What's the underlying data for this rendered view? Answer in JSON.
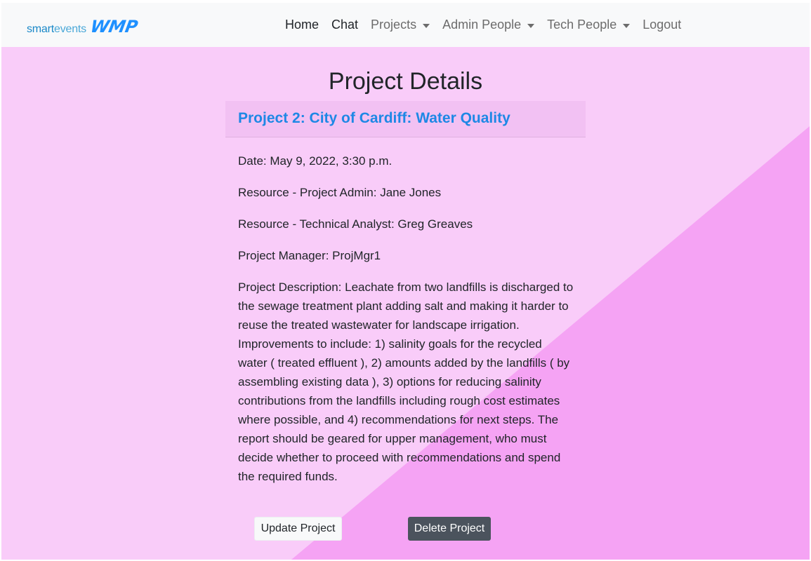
{
  "navbar": {
    "brand": {
      "smart": "smart",
      "events": "events",
      "wmp": "WMP"
    },
    "links": [
      {
        "label": "Home"
      },
      {
        "label": "Chat"
      },
      {
        "label": "Projects"
      },
      {
        "label": "Admin People"
      },
      {
        "label": "Tech People"
      },
      {
        "label": "Logout"
      }
    ]
  },
  "page": {
    "title": "Project Details"
  },
  "project": {
    "heading": "Project 2: City of Cardiff: Water Quality",
    "date": "Date: May 9, 2022, 3:30 p.m.",
    "admin": "Resource - Project Admin: Jane Jones",
    "analyst": "Resource - Technical Analyst: Greg Greaves",
    "manager": "Project Manager: ProjMgr1",
    "description": "Project Description: Leachate from two landfills is discharged to the sewage treatment plant adding salt and making it harder to reuse the treated wastewater for landscape irrigation. Improvements to include: 1) salinity goals for the recycled water ( treated effluent ), 2) amounts added by the landfills ( by assembling existing data ), 3) options for reducing salinity contributions from the landfills including rough cost estimates where possible, and 4) recommendations for next steps. The report should be geared for upper management, who must decide whether to proceed with recommendations and spend the required funds."
  },
  "actions": {
    "update_label": "Update Project",
    "delete_label": "Delete Project"
  },
  "colors": {
    "background": "#f9ccf9",
    "diagonal": "#f5a3f4",
    "heading_blue": "#1e88e5",
    "nav_bg": "#f8f9fa"
  }
}
